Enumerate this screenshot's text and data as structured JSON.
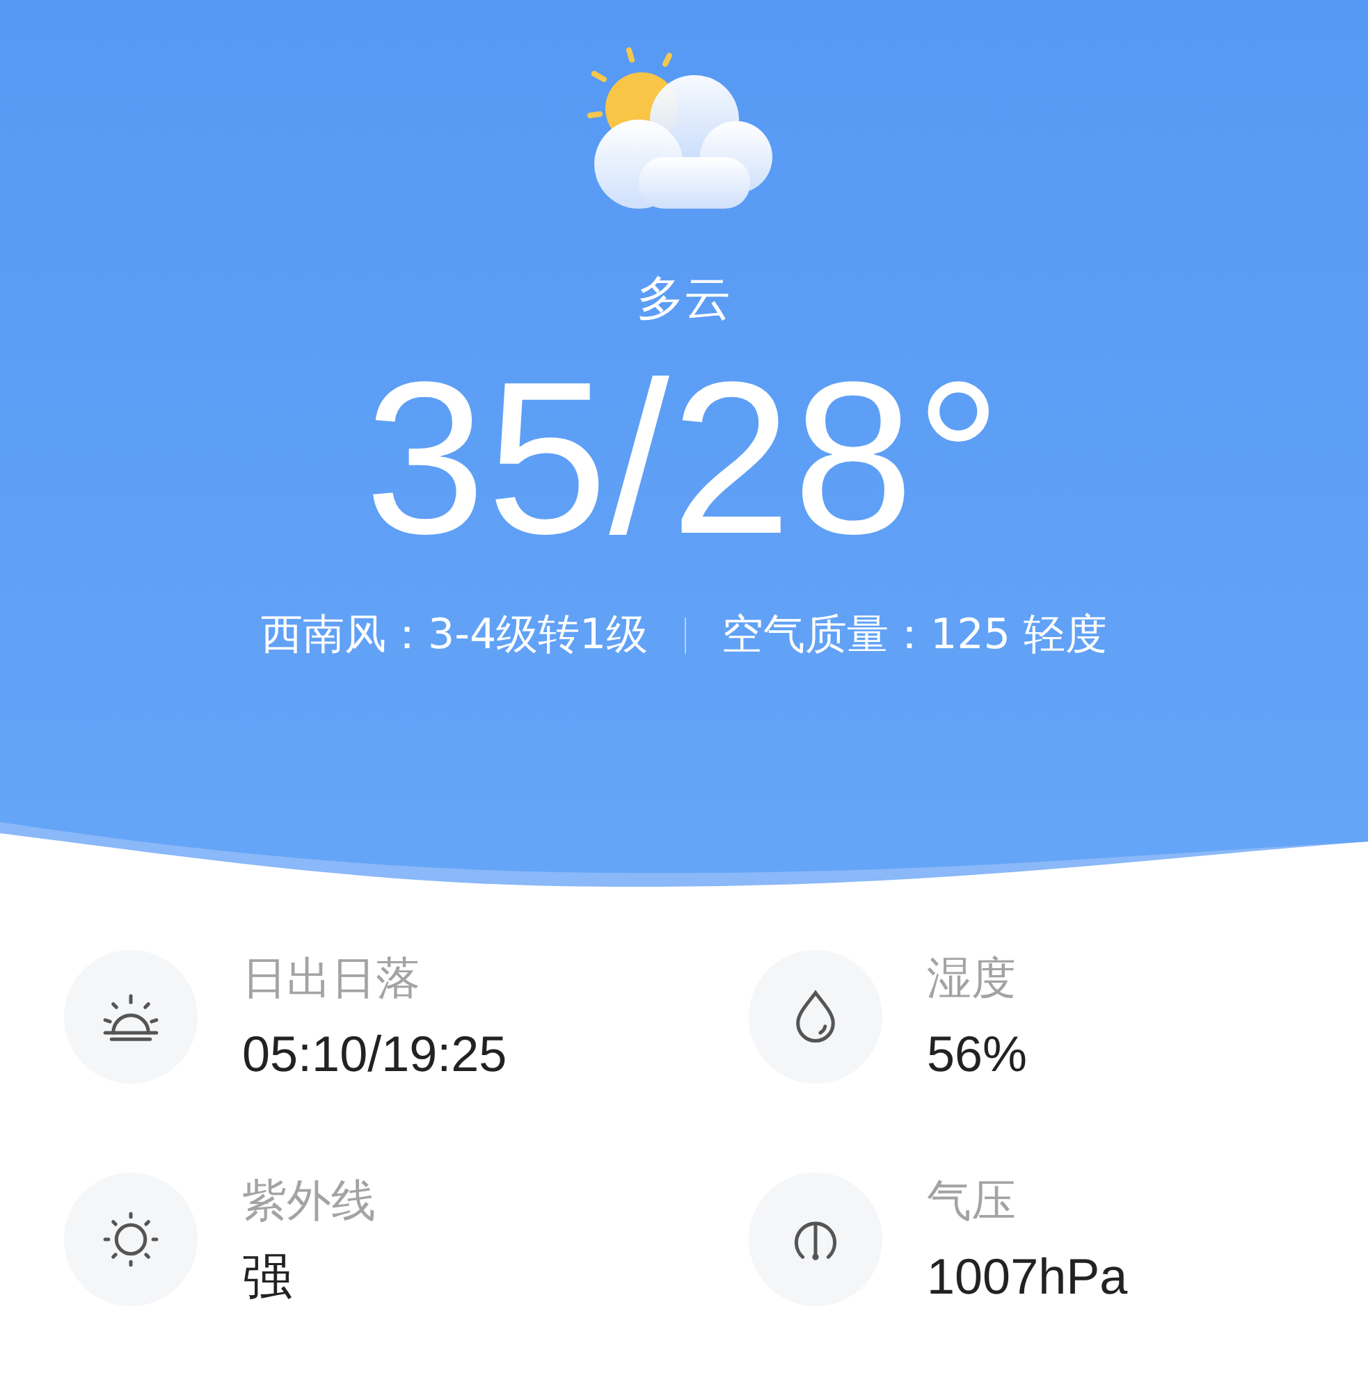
{
  "weather": {
    "condition": "多云",
    "temperature": "35/28°",
    "wind": "西南风：3-4级转1级",
    "air_quality": "空气质量：125 轻度"
  },
  "details": [
    {
      "kind": "sunrise",
      "label": "日出日落",
      "value": "05:10/19:25"
    },
    {
      "kind": "humidity",
      "label": "湿度",
      "value": "56%"
    },
    {
      "kind": "uv",
      "label": "紫外线",
      "value": "强"
    },
    {
      "kind": "pressure",
      "label": "气压",
      "value": "1007hPa"
    }
  ]
}
